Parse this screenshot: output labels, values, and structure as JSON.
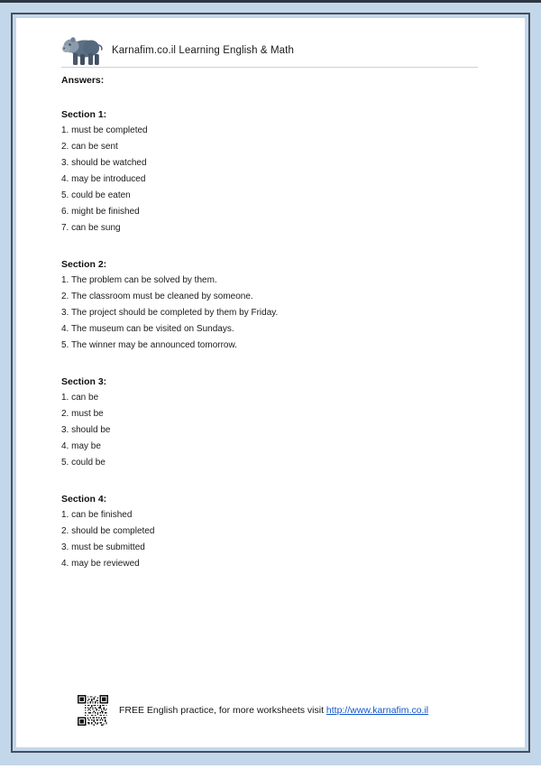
{
  "header": {
    "logo_icon": "hippo-logo-icon",
    "brand_title": "Karnafim.co.il Learning English & Math"
  },
  "document": {
    "answers_label": "Answers:"
  },
  "sections": [
    {
      "title": "Section 1:",
      "items": [
        "1. must be completed",
        "2. can be sent",
        "3. should be watched",
        "4. may be introduced",
        "5. could be eaten",
        "6. might be finished",
        "7. can be sung"
      ]
    },
    {
      "title": "Section 2:",
      "items": [
        "1. The problem can be solved by them.",
        "2. The classroom must be cleaned by someone.",
        "3. The project should be completed by them by Friday.",
        "4. The museum can be visited on Sundays.",
        "5. The winner may be announced tomorrow."
      ]
    },
    {
      "title": "Section 3:",
      "items": [
        "1. can be",
        "2. must be",
        "3. should be",
        "4. may be",
        "5. could be"
      ]
    },
    {
      "title": "Section 4:",
      "items": [
        "1. can be finished",
        "2. should be completed",
        "3. must be submitted",
        "4. may be reviewed"
      ]
    }
  ],
  "footer": {
    "qr_icon": "qr-code-icon",
    "text_before_link": "FREE English practice, for more worksheets visit ",
    "link_label": "http://www.karnafim.co.il"
  },
  "colors": {
    "mat": "#c3d7ea",
    "frame": "#454f5c",
    "paper": "#ffffff",
    "link": "#1155cc",
    "rule": "#cfcfcf",
    "text": "#1a1a1a",
    "logo_body": "#5b6f85",
    "logo_head": "#8b9bab"
  }
}
